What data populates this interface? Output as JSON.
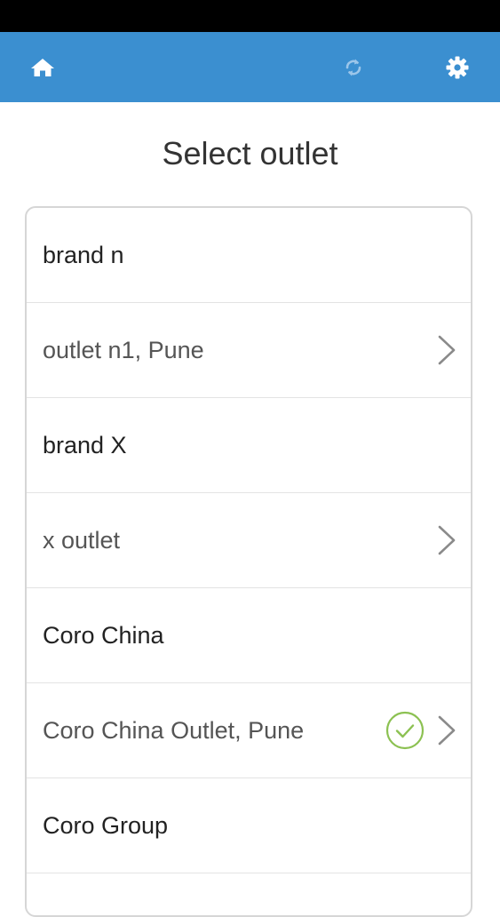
{
  "header": {
    "home_icon": "home-icon",
    "sync_icon": "sync-icon",
    "settings_icon": "gear-icon",
    "background_color": "#3b8fd0"
  },
  "page": {
    "title": "Select outlet"
  },
  "list": {
    "items": [
      {
        "type": "brand",
        "label": "brand n"
      },
      {
        "type": "outlet",
        "label": "outlet n1, Pune",
        "selected": false
      },
      {
        "type": "brand",
        "label": "brand X"
      },
      {
        "type": "outlet",
        "label": "x outlet",
        "selected": false
      },
      {
        "type": "brand",
        "label": "Coro China"
      },
      {
        "type": "outlet",
        "label": "Coro China Outlet, Pune",
        "selected": true
      },
      {
        "type": "brand",
        "label": "Coro Group"
      }
    ],
    "selected_color": "#8cc152"
  }
}
